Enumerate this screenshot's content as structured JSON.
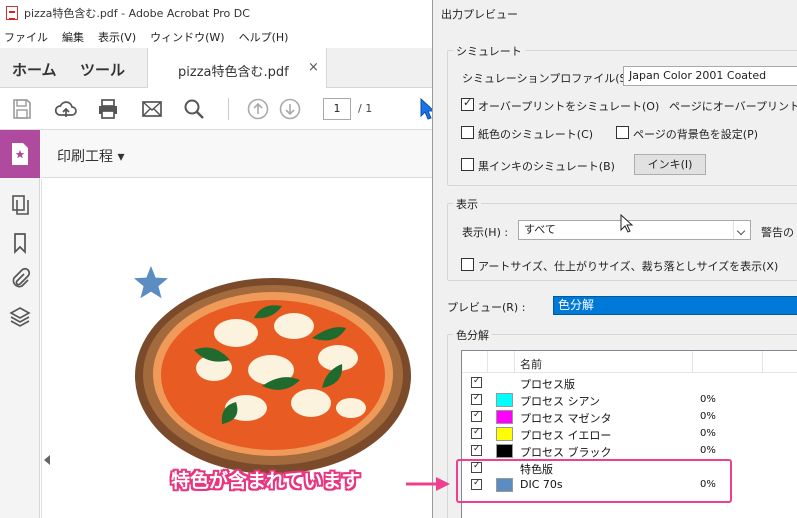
{
  "app": {
    "title": "pizza特色含む.pdf - Adobe Acrobat Pro DC",
    "menu": [
      "ファイル",
      "編集",
      "表示(V)",
      "ウィンドウ(W)",
      "ヘルプ(H)"
    ],
    "tabs": {
      "home": "ホーム",
      "tools": "ツール",
      "document": "pizza特色含む.pdf",
      "close": "×"
    },
    "page": {
      "current": "1",
      "total": "/ 1"
    },
    "tool_header": "印刷工程 ▾"
  },
  "dialog": {
    "title": "出力プレビュー",
    "simulate": {
      "group_label": "シミュレート",
      "profile_label": "シミュレーションプロファイル(S) :",
      "profile_value": "Japan Color 2001 Coated",
      "overprint_label": "オーバープリントをシミュレート(O)",
      "overprint_checked": true,
      "page_overprint_label": "ページにオーバープリントが",
      "paper_color_label": "紙色のシミュレート(C)",
      "paper_color_checked": false,
      "page_bg_label": "ページの背景色を設定(P)",
      "page_bg_checked": false,
      "black_ink_label": "黒インキのシミュレート(B)",
      "black_ink_checked": false,
      "ink_button": "インキ(I)"
    },
    "display": {
      "group_label": "表示",
      "show_label": "表示(H) :",
      "show_value": "すべて",
      "warning_label": "警告の",
      "artsize_label": "アートサイズ、仕上がりサイズ、裁ち落としサイズを表示(X)",
      "artsize_checked": false
    },
    "preview": {
      "label": "プレビュー(R) :",
      "value": "色分解"
    },
    "separations": {
      "group_label": "色分解",
      "header_name": "名前",
      "rows": [
        {
          "checked": true,
          "name": "プロセス版",
          "color": "",
          "pct": ""
        },
        {
          "checked": true,
          "name": "プロセス シアン",
          "color": "#00ffff",
          "pct": "0%"
        },
        {
          "checked": true,
          "name": "プロセス マゼンタ",
          "color": "#ff00ff",
          "pct": "0%"
        },
        {
          "checked": true,
          "name": "プロセス イエロー",
          "color": "#ffff00",
          "pct": "0%"
        },
        {
          "checked": true,
          "name": "プロセス ブラック",
          "color": "#000000",
          "pct": "0%"
        },
        {
          "checked": true,
          "name": "特色版",
          "color": "",
          "pct": ""
        },
        {
          "checked": true,
          "name": "DIC 70s",
          "color": "#5b8cc2",
          "pct": "0%"
        }
      ]
    }
  },
  "annotation": {
    "callout_text": "特色が含まれています",
    "color": "#ef3f8f"
  },
  "icons": [
    "save-icon",
    "upload-icon",
    "print-icon",
    "mail-icon",
    "search-icon",
    "page-up-icon",
    "page-down-icon",
    "cursor-arrow-icon",
    "pages-icon",
    "bookmark-icon",
    "attachment-icon",
    "layers-icon",
    "print-production-icon"
  ]
}
